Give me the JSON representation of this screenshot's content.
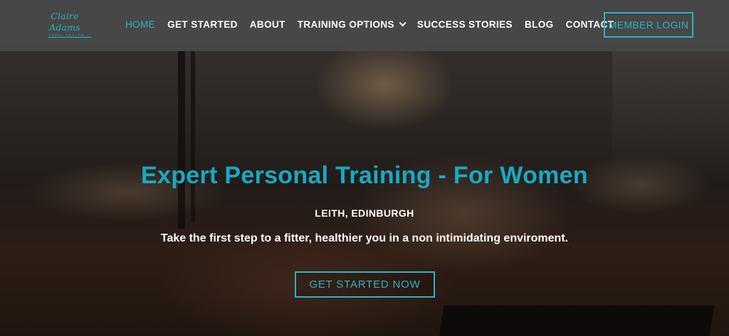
{
  "brand": {
    "logo_script": "Claire Adams",
    "logo_sub": "TOTAL HEALTH"
  },
  "nav": {
    "items": [
      {
        "label": "HOME",
        "active": true
      },
      {
        "label": "GET STARTED"
      },
      {
        "label": "ABOUT"
      },
      {
        "label": "TRAINING OPTIONS",
        "has_dropdown": true
      },
      {
        "label": "SUCCESS STORIES"
      },
      {
        "label": "BLOG"
      },
      {
        "label": "CONTACT"
      }
    ],
    "login_label": "MEMBER LOGIN"
  },
  "hero": {
    "title": "Expert Personal Training - For Women",
    "location": "LEITH, EDINBURGH",
    "tagline": "Take the first step to a fitter, healthier you in a non intimidating enviroment.",
    "cta_label": "GET STARTED NOW"
  },
  "colors": {
    "accent": "#2ab3c5",
    "header_bg": "#484848",
    "text": "#ffffff"
  }
}
